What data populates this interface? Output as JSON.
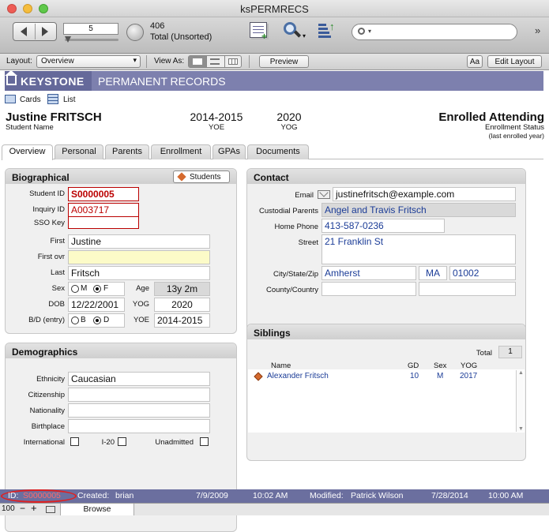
{
  "window": {
    "title": "ksPERMRECS"
  },
  "toolbar": {
    "record_field": "5",
    "record_count": "406",
    "found_status": "Total (Unsorted)"
  },
  "layoutbar": {
    "layout_label": "Layout:",
    "layout_value": "Overview",
    "view_as_label": "View As:",
    "preview_label": "Preview",
    "aa_label": "Aa",
    "edit_layout_label": "Edit Layout"
  },
  "banner": {
    "logo": "KEYSTONE",
    "title": "PERMANENT RECORDS"
  },
  "views": {
    "cards": "Cards",
    "list": "List"
  },
  "header": {
    "student_name": "Justine FRITSCH",
    "student_name_label": "Student Name",
    "yoe": "2014-2015",
    "yoe_label": "YOE",
    "yog": "2020",
    "yog_label": "YOG",
    "status": "Enrolled Attending",
    "status_label": "Enrollment Status",
    "status_sub": "(last enrolled year)"
  },
  "tabs": [
    {
      "label": "Overview"
    },
    {
      "label": "Personal"
    },
    {
      "label": "Parents"
    },
    {
      "label": "Enrollment"
    },
    {
      "label": "GPAs"
    },
    {
      "label": "Documents"
    }
  ],
  "bio": {
    "title": "Biographical",
    "students_btn": "Students",
    "student_id_label": "Student ID",
    "student_id": "S0000005",
    "inquiry_id_label": "Inquiry ID",
    "inquiry_id": "A003717",
    "sso_label": "SSO Key",
    "sso": "",
    "first_label": "First",
    "first": "Justine",
    "first_ovr_label": "First ovr",
    "first_ovr": "",
    "last_label": "Last",
    "last": "Fritsch",
    "sex_label": "Sex",
    "sex_m": "M",
    "sex_f": "F",
    "age_label": "Age",
    "age": "13y 2m",
    "dob_label": "DOB",
    "dob": "12/22/2001",
    "yog_label": "YOG",
    "yog": "2020",
    "bd_label": "B/D (entry)",
    "bd_b": "B",
    "bd_d": "D",
    "yoe_label": "YOE",
    "yoe": "2014-2015"
  },
  "demo": {
    "title": "Demographics",
    "ethnicity_label": "Ethnicity",
    "ethnicity": "Caucasian",
    "citizenship_label": "Citizenship",
    "citizenship": "",
    "nationality_label": "Nationality",
    "nationality": "",
    "birthplace_label": "Birthplace",
    "birthplace": "",
    "international_label": "International",
    "i20_label": "I-20",
    "unadmitted_label": "Unadmitted"
  },
  "contact": {
    "title": "Contact",
    "email_label": "Email",
    "email": "justinefritsch@example.com",
    "custodial_label": "Custodial Parents",
    "custodial": "Angel and Travis Fritsch",
    "phone_label": "Home Phone",
    "phone": "413-587-0236",
    "street_label": "Street",
    "street": "21 Franklin St",
    "csz_label": "City/State/Zip",
    "city": "Amherst",
    "state": "MA",
    "zip": "01002",
    "county_label": "County/Country",
    "county": "",
    "country": ""
  },
  "siblings": {
    "title": "Siblings",
    "total_label": "Total",
    "total": "1",
    "cols": {
      "name": "Name",
      "gd": "GD",
      "sex": "Sex",
      "yog": "YOG"
    },
    "rows": [
      {
        "name": "Alexander Fritsch",
        "gd": "10",
        "sex": "M",
        "yog": "2017"
      }
    ]
  },
  "status": {
    "id_label": "ID:",
    "id": "S0000005",
    "created_label": "Created:",
    "created_by": "brian",
    "created_date": "7/9/2009",
    "created_time": "10:02 AM",
    "modified_label": "Modified:",
    "modified_by": "Patrick Wilson",
    "modified_date": "7/28/2014",
    "modified_time": "10:00 AM"
  },
  "bottom": {
    "zoom": "100",
    "mode": "Browse"
  }
}
